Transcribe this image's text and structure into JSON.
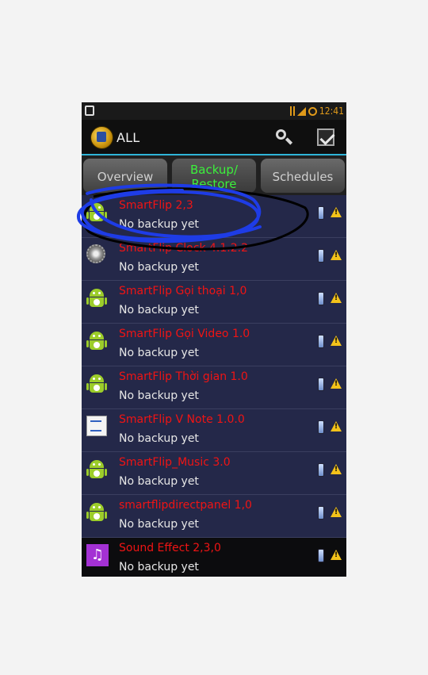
{
  "status_bar": {
    "time": "12:41",
    "icons": [
      "notification-icon",
      "usb-icon",
      "signal-icon",
      "alarm-icon"
    ]
  },
  "action_bar": {
    "title": "ALL",
    "icons": [
      "app-logo-icon",
      "search-icon",
      "batch-select-icon"
    ]
  },
  "tabs": [
    {
      "label": "Overview"
    },
    {
      "label": "Backup/\nRestore",
      "line1": "Backup/",
      "line2": "Restore",
      "active": true
    },
    {
      "label": "Schedules"
    }
  ],
  "apps": [
    {
      "name": "SmartFlip 2,3",
      "status": "No backup yet",
      "icon": "android-icon"
    },
    {
      "name": "SmartFlip Clock 4.1.2.2",
      "status": "No backup yet",
      "icon": "gear-icon"
    },
    {
      "name": "SmartFlip Gọi thoại 1,0",
      "status": "No backup yet",
      "icon": "android-icon"
    },
    {
      "name": "SmartFlip Gọi Video 1.0",
      "status": "No backup yet",
      "icon": "android-icon"
    },
    {
      "name": "SmartFlip Thời gian 1.0",
      "status": "No backup yet",
      "icon": "android-icon"
    },
    {
      "name": "SmartFlip V Note 1.0.0",
      "status": "No backup yet",
      "icon": "vnote-icon"
    },
    {
      "name": "SmartFlip_Music 3.0",
      "status": "No backup yet",
      "icon": "android-icon"
    },
    {
      "name": "smartflipdirectpanel 1,0",
      "status": "No backup yet",
      "icon": "android-icon"
    },
    {
      "name": "Sound Effect 2,3,0",
      "status": "No backup yet",
      "icon": "music-icon"
    }
  ],
  "colors": {
    "app_name": "#f01414",
    "active_tab": "#3cf03c",
    "list_background": "#242849",
    "annotation_blue": "#1e3ce6",
    "annotation_black": "#000000",
    "action_bar_underline": "#2fb4d8"
  }
}
